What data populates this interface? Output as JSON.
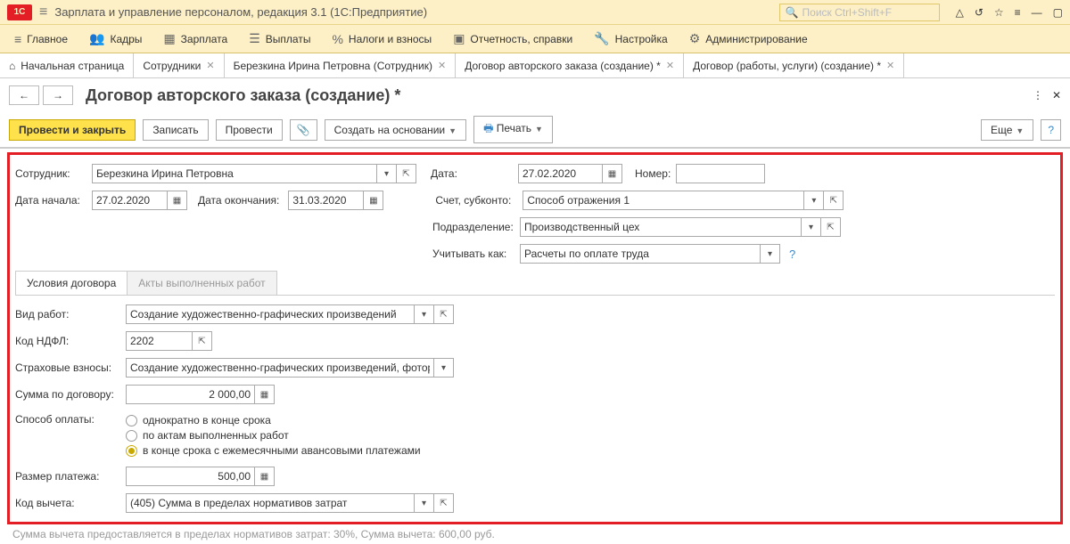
{
  "app_title": "Зарплата и управление персоналом, редакция 3.1  (1С:Предприятие)",
  "search_placeholder": "Поиск Ctrl+Shift+F",
  "menu": [
    "Главное",
    "Кадры",
    "Зарплата",
    "Выплаты",
    "Налоги и взносы",
    "Отчетность, справки",
    "Настройка",
    "Администрирование"
  ],
  "tabs": [
    {
      "label": "Начальная страница",
      "closable": false
    },
    {
      "label": "Сотрудники",
      "closable": true
    },
    {
      "label": "Березкина Ирина Петровна (Сотрудник)",
      "closable": true
    },
    {
      "label": "Договор авторского заказа (создание) *",
      "closable": true
    },
    {
      "label": "Договор (работы, услуги) (создание) *",
      "closable": true
    }
  ],
  "page_title": "Договор авторского заказа (создание) *",
  "toolbar": {
    "post_close": "Провести и закрыть",
    "write": "Записать",
    "post": "Провести",
    "create_based": "Создать на основании",
    "print": "Печать",
    "more": "Еще"
  },
  "form": {
    "employee_lbl": "Сотрудник:",
    "employee": "Березкина Ирина Петровна",
    "date_lbl": "Дата:",
    "date": "27.02.2020",
    "number_lbl": "Номер:",
    "number": "",
    "start_lbl": "Дата начала:",
    "start": "27.02.2020",
    "end_lbl": "Дата окончания:",
    "end": "31.03.2020",
    "account_lbl": "Счет, субконто:",
    "account": "Способ отражения 1",
    "dept_lbl": "Подразделение:",
    "dept": "Производственный цех",
    "treat_lbl": "Учитывать как:",
    "treat": "Расчеты по оплате труда",
    "tabs": [
      "Условия договора",
      "Акты выполненных работ"
    ],
    "worktype_lbl": "Вид работ:",
    "worktype": "Создание художественно-графических произведений",
    "ndfl_lbl": "Код НДФЛ:",
    "ndfl": "2202",
    "ins_lbl": "Страховые взносы:",
    "ins": "Создание художественно-графических произведений, фотораб",
    "sum_lbl": "Сумма по договору:",
    "sum": "2 000,00",
    "paym_lbl": "Способ оплаты:",
    "paym_opts": [
      "однократно в конце срока",
      "по актам выполненных работ",
      "в конце срока с ежемесячными авансовыми платежами"
    ],
    "paym_selected": 2,
    "size_lbl": "Размер платежа:",
    "size": "500,00",
    "deduct_lbl": "Код вычета:",
    "deduct": "(405) Сумма в пределах нормативов затрат"
  },
  "footer": "Сумма вычета предоставляется в пределах нормативов затрат: 30%,  Сумма вычета: 600,00 руб."
}
